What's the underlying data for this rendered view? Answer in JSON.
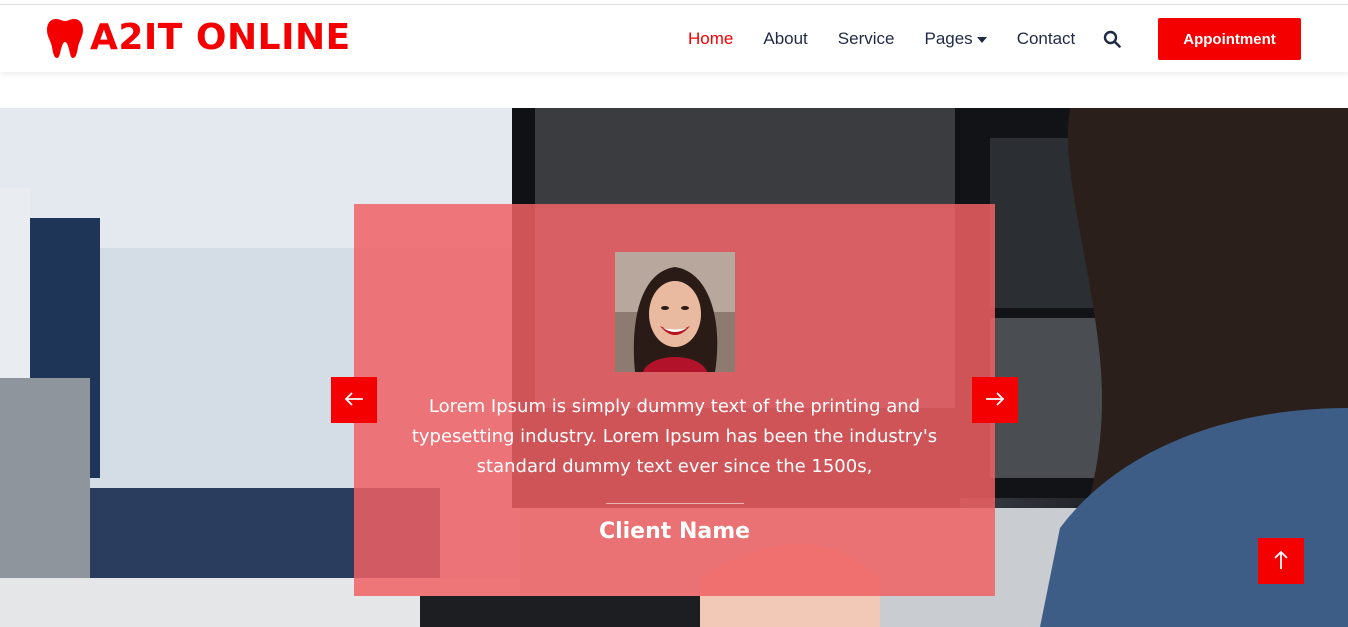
{
  "brand": {
    "name": "A2IT ONLINE",
    "icon": "tooth-icon",
    "color": "#f40000"
  },
  "nav": {
    "items": [
      {
        "label": "Home",
        "active": true
      },
      {
        "label": "About",
        "active": false
      },
      {
        "label": "Service",
        "active": false
      },
      {
        "label": "Pages",
        "active": false,
        "dropdown": true
      },
      {
        "label": "Contact",
        "active": false
      }
    ],
    "search_icon": "search-icon",
    "appointment_label": "Appointment"
  },
  "testimonial": {
    "quote": "Lorem Ipsum is simply dummy text of the printing and typesetting industry. Lorem Ipsum has been the industry's standard dummy text ever since the 1500s,",
    "client_name": "Client Name",
    "photo": "client-photo"
  },
  "controls": {
    "prev_icon": "arrow-left-icon",
    "next_icon": "arrow-right-icon",
    "back_to_top_icon": "arrow-up-icon"
  },
  "colors": {
    "accent": "#f40000",
    "nav_text": "#1f2a44",
    "card_overlay": "#f06064"
  }
}
